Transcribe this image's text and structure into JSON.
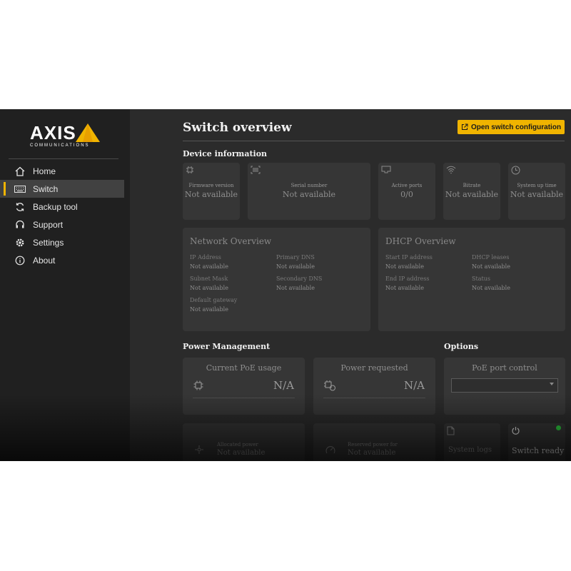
{
  "brand": {
    "name": "AXIS",
    "subtitle": "COMMUNICATIONS",
    "accent": "#f0b400"
  },
  "sidebar": {
    "items": [
      {
        "label": "Home",
        "icon": "home-icon",
        "active": false
      },
      {
        "label": "Switch",
        "icon": "keyboard-icon",
        "active": true
      },
      {
        "label": "Backup tool",
        "icon": "sync-icon",
        "active": false
      },
      {
        "label": "Support",
        "icon": "headset-icon",
        "active": false
      },
      {
        "label": "Settings",
        "icon": "gear-icon",
        "active": false
      },
      {
        "label": "About",
        "icon": "info-icon",
        "active": false
      }
    ]
  },
  "header": {
    "title": "Switch overview",
    "open_button": "Open switch configuration"
  },
  "device_info": {
    "title": "Device information",
    "cards": [
      {
        "label": "Firmware version",
        "value": "Not available",
        "icon": "chip-icon"
      },
      {
        "label": "Serial number",
        "value": "Not available",
        "icon": "barcode-icon"
      },
      {
        "label": "Active ports",
        "value": "0/0",
        "icon": "port-icon"
      },
      {
        "label": "Bitrate",
        "value": "Not available",
        "icon": "wifi-icon"
      },
      {
        "label": "System up time",
        "value": "Not available",
        "icon": "clock-icon"
      }
    ]
  },
  "network": {
    "title": "Network Overview",
    "fields": [
      {
        "key": "IP Address",
        "value": "Not available"
      },
      {
        "key": "Primary DNS",
        "value": "Not available"
      },
      {
        "key": "Subnet Mask",
        "value": "Not available"
      },
      {
        "key": "Secondary DNS",
        "value": "Not available"
      },
      {
        "key": "Default gateway",
        "value": "Not available"
      }
    ]
  },
  "dhcp": {
    "title": "DHCP Overview",
    "fields": [
      {
        "key": "Start IP address",
        "value": "Not available"
      },
      {
        "key": "DHCP leases",
        "value": "Not available"
      },
      {
        "key": "End IP address",
        "value": "Not available"
      },
      {
        "key": "Status",
        "value": "Not available"
      }
    ]
  },
  "power": {
    "title": "Power Management",
    "current": {
      "label": "Current PoE usage",
      "value": "N/A"
    },
    "requested": {
      "label": "Power requested",
      "value": "N/A"
    },
    "budget": {
      "label": "Allocated power",
      "value": "Not available"
    },
    "reserved": {
      "label": "Reserved power for",
      "value": "Not available"
    }
  },
  "options": {
    "title": "Options",
    "poe_control": "PoE port control",
    "select_value": ""
  },
  "bottom": {
    "system_logs": "System logs",
    "status": "Switch ready",
    "status_color": "#2ecc40"
  }
}
